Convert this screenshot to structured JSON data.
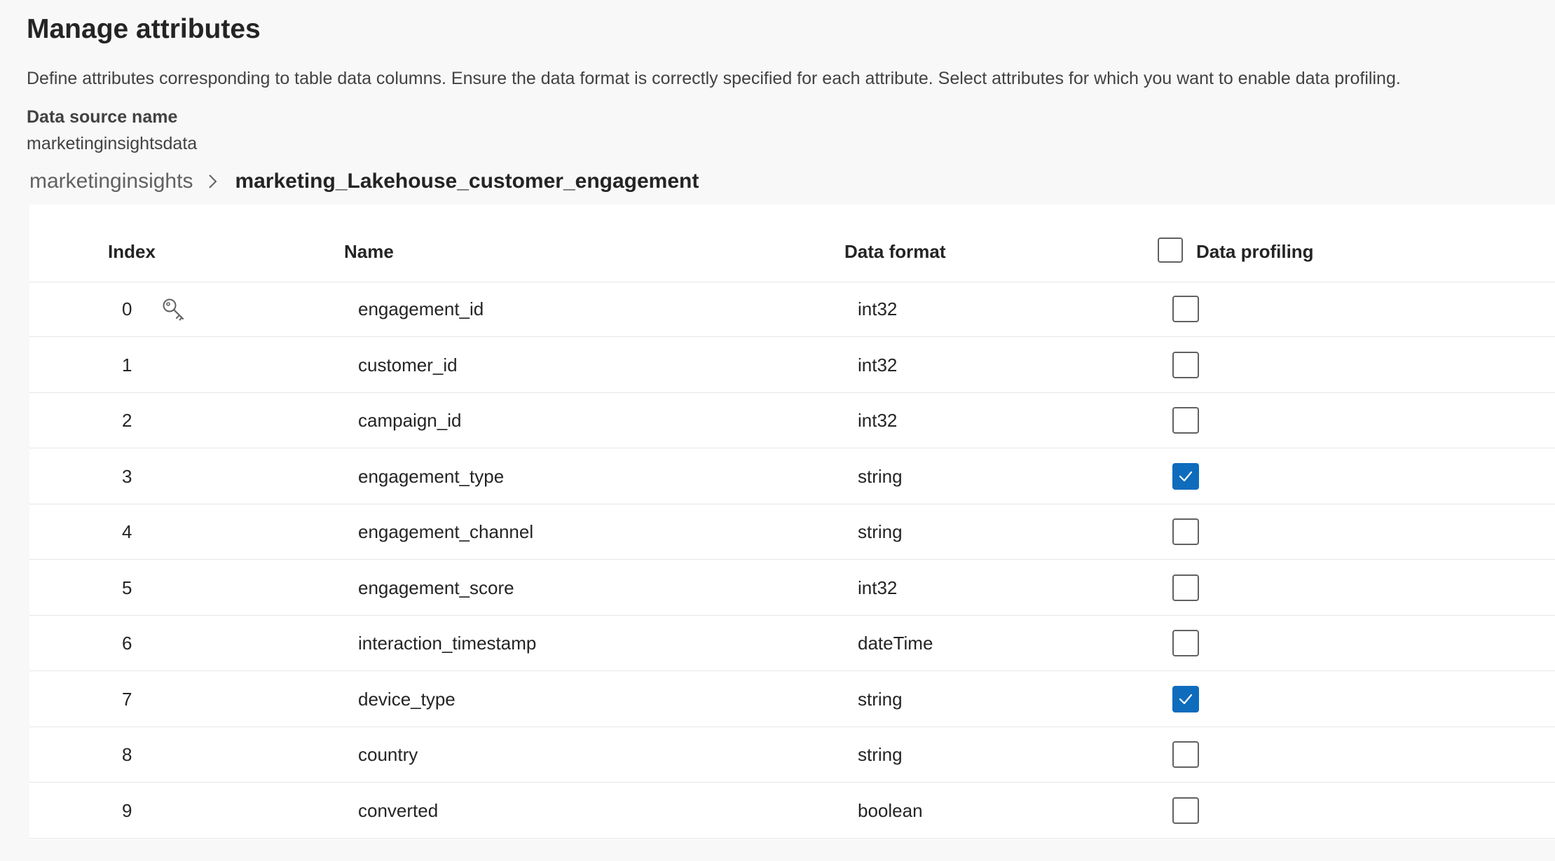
{
  "page": {
    "title": "Manage attributes",
    "description": "Define attributes corresponding to table data columns. Ensure the data format is correctly specified for each attribute. Select attributes for which you want to enable data profiling.",
    "data_source_label": "Data source name",
    "data_source_value": "marketinginsightsdata"
  },
  "breadcrumb": {
    "root": "marketinginsights",
    "current": "marketing_Lakehouse_customer_engagement"
  },
  "table": {
    "headers": {
      "index": "Index",
      "name": "Name",
      "format": "Data format",
      "profiling": "Data profiling"
    },
    "header_checkbox_checked": false,
    "rows": [
      {
        "index": "0",
        "name": "engagement_id",
        "format": "int32",
        "profiling": false,
        "primary_key": true
      },
      {
        "index": "1",
        "name": "customer_id",
        "format": "int32",
        "profiling": false,
        "primary_key": false
      },
      {
        "index": "2",
        "name": "campaign_id",
        "format": "int32",
        "profiling": false,
        "primary_key": false
      },
      {
        "index": "3",
        "name": "engagement_type",
        "format": "string",
        "profiling": true,
        "primary_key": false
      },
      {
        "index": "4",
        "name": "engagement_channel",
        "format": "string",
        "profiling": false,
        "primary_key": false
      },
      {
        "index": "5",
        "name": "engagement_score",
        "format": "int32",
        "profiling": false,
        "primary_key": false
      },
      {
        "index": "6",
        "name": "interaction_timestamp",
        "format": "dateTime",
        "profiling": false,
        "primary_key": false
      },
      {
        "index": "7",
        "name": "device_type",
        "format": "string",
        "profiling": true,
        "primary_key": false
      },
      {
        "index": "8",
        "name": "country",
        "format": "string",
        "profiling": false,
        "primary_key": false
      },
      {
        "index": "9",
        "name": "converted",
        "format": "boolean",
        "profiling": false,
        "primary_key": false
      }
    ]
  },
  "icons": {
    "primary_key": "key-icon",
    "breadcrumb_separator": "chevron-right-icon",
    "checkmark": "checkmark-icon"
  },
  "colors": {
    "accent": "#0f6cbd",
    "background": "#f8f8f8",
    "panel": "#ffffff",
    "divider": "#e6e6e6"
  }
}
